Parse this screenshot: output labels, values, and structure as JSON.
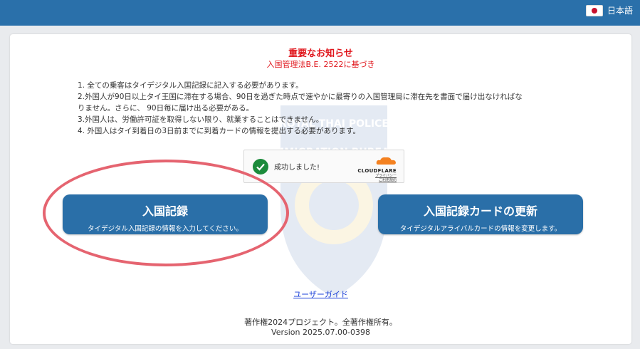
{
  "header": {
    "language_label": "日本語",
    "language_flag_icon": "japan-flag-icon",
    "bar_color": "#2a70aa"
  },
  "notice": {
    "title": "重要なお知らせ",
    "subtitle": "入国管理法B.E. 2522に基づき",
    "lines": [
      "1. 全ての乗客はタイデジタル入国記録に記入する必要があります。",
      "2.外国人が90日以上タイ王国に滞在する場合、90日を過ぎた時点で速やかに最寄りの入国管理局に滞在先を書面で届け出なければな",
      "りません。さらに、 90日毎に届け出る必要がある。",
      "3.外国人は、労働許可証を取得しない限り、就業することはできません。",
      "4. 外国人はタイ到着日の3日前までに到着カードの情報を提出する必要があります。"
    ],
    "title_color": "#e0151b"
  },
  "captcha": {
    "status": "成功しました!",
    "provider": "CLOUDFLARE",
    "privacy_link": "プライバシー",
    "terms_link": "ご利用規約",
    "check_icon": "checkmark-icon"
  },
  "actions": {
    "entry_record": {
      "label": "入国記録",
      "description": "タイデジタル入国記録の情報を入力してください。"
    },
    "update_card": {
      "label": "入国記録カードの更新",
      "description": "タイデジタルアライバルカードの情報を変更します。"
    },
    "button_color": "#2a6fa8"
  },
  "footer": {
    "user_guide": "ユーザーガイド",
    "copyright": "著作権2024プロジェクト。全著作権所有。",
    "version": "Version 2025.07.00-0398"
  },
  "watermark": {
    "lines": [
      "ROYAL THAI POLICE",
      "IMMIGRATION BUREAU"
    ]
  },
  "highlight_color": "#e56470"
}
